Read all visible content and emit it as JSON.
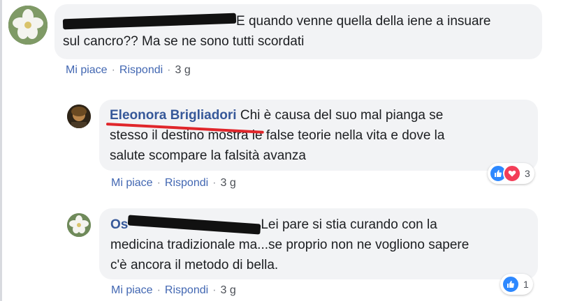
{
  "comments": [
    {
      "author_redacted": true,
      "text_line1": "E quando venne quella della iene a insuare",
      "text_line2": "sul cancro?? Ma se ne sono tutti scordati",
      "like_label": "Mi piace",
      "reply_label": "Rispondi",
      "time": "3 g"
    },
    {
      "author": "Eleonora Brigliadori",
      "text_line1": "Chi è causa del suo mal pianga se",
      "text_line2": "stesso il destino mostra le false teorie nella vita e dove la",
      "text_line3": "salute scompare la falsità avanza",
      "like_label": "Mi piace",
      "reply_label": "Rispondi",
      "time": "3 g",
      "reaction_count": "3"
    },
    {
      "author_visible": "Os",
      "author_redacted": true,
      "text_line1": "Lei pare si stia curando con la",
      "text_line2": "medicina tradizionale ma...se proprio non ne vogliono sapere",
      "text_line3": "c'è ancora il metodo di bella.",
      "like_label": "Mi piace",
      "reply_label": "Rispondi",
      "time": "3 g",
      "reaction_count": "1"
    }
  ],
  "separator": "·",
  "colors": {
    "link": "#4267b2",
    "author": "#365899",
    "bubble": "#f2f3f5",
    "underline": "#e0262b",
    "like": "#2d88ff",
    "love": "#f33e58"
  },
  "icons": [
    "flower-avatar-icon",
    "person-avatar-icon",
    "like-reaction-icon",
    "love-reaction-icon"
  ]
}
